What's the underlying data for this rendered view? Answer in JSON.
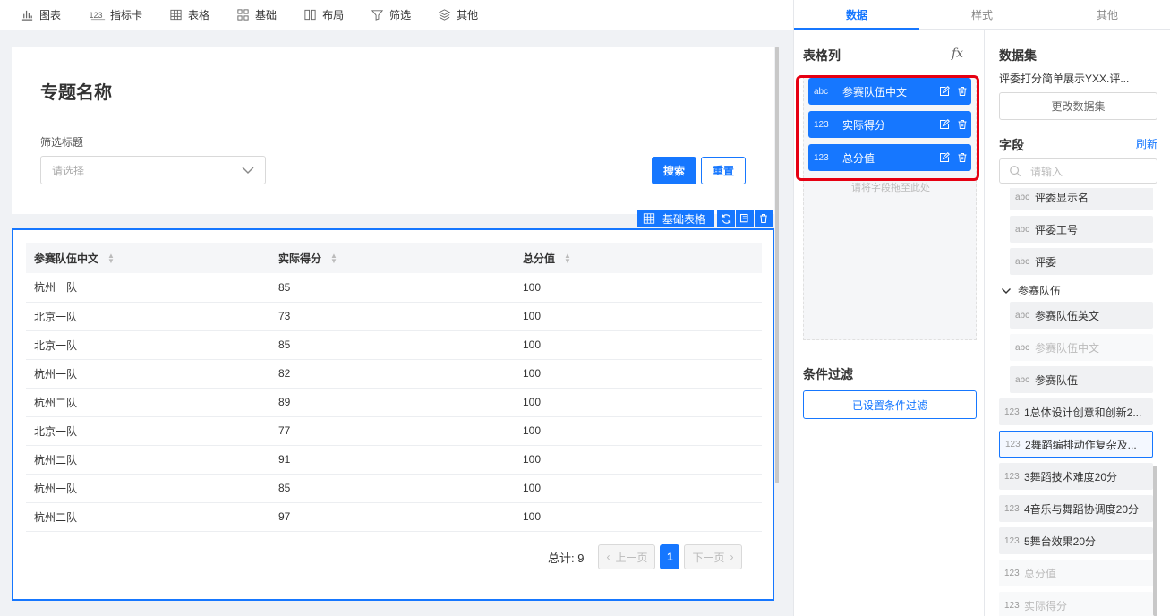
{
  "toolbar": {
    "items": [
      {
        "icon": "bar-chart-icon",
        "label": "图表"
      },
      {
        "icon": "number-icon",
        "label": "指标卡"
      },
      {
        "icon": "table-icon",
        "label": "表格"
      },
      {
        "icon": "grid-icon",
        "label": "基础"
      },
      {
        "icon": "layout-icon",
        "label": "布局"
      },
      {
        "icon": "filter-icon",
        "label": "筛选"
      },
      {
        "icon": "layers-icon",
        "label": "其他"
      }
    ]
  },
  "page": {
    "title": "专题名称",
    "filter_label": "筛选标题",
    "select_placeholder": "请选择",
    "search_button": "搜索",
    "reset_button": "重置"
  },
  "widget": {
    "name": "基础表格"
  },
  "table": {
    "headers": [
      "参赛队伍中文",
      "实际得分",
      "总分值"
    ],
    "rows": [
      [
        "杭州一队",
        "85",
        "100"
      ],
      [
        "北京一队",
        "73",
        "100"
      ],
      [
        "北京一队",
        "85",
        "100"
      ],
      [
        "杭州一队",
        "82",
        "100"
      ],
      [
        "杭州二队",
        "89",
        "100"
      ],
      [
        "北京一队",
        "77",
        "100"
      ],
      [
        "杭州二队",
        "91",
        "100"
      ],
      [
        "杭州一队",
        "85",
        "100"
      ],
      [
        "杭州二队",
        "97",
        "100"
      ]
    ],
    "pager": {
      "total": "总计: 9",
      "prev": "上一页",
      "page": "1",
      "next": "下一页"
    }
  },
  "panel": {
    "tabs": [
      "数据",
      "样式",
      "其他"
    ],
    "columns_title": "表格列",
    "columns": [
      {
        "type": "abc",
        "name": "参赛队伍中文"
      },
      {
        "type": "123",
        "name": "实际得分"
      },
      {
        "type": "123",
        "name": "总分值"
      }
    ],
    "drop_hint": "请将字段拖至此处",
    "condition_title": "条件过滤",
    "condition_button": "已设置条件过滤",
    "dataset_title": "数据集",
    "dataset_name": "评委打分简单展示YXX.评...",
    "change_dataset": "更改数据集",
    "fields_title": "字段",
    "refresh": "刷新",
    "search_placeholder": "请输入",
    "group_label": "参赛队伍",
    "fields": [
      {
        "type": "abc",
        "name": "评委显示名"
      },
      {
        "type": "abc",
        "name": "评委工号"
      },
      {
        "type": "abc",
        "name": "评委"
      },
      {
        "type": "abc",
        "name": "参赛队伍英文"
      },
      {
        "type": "abc",
        "name": "参赛队伍中文"
      },
      {
        "type": "abc",
        "name": "参赛队伍"
      },
      {
        "type": "123",
        "name": "1总体设计创意和创新2..."
      },
      {
        "type": "123",
        "name": "2舞蹈编排动作复杂及..."
      },
      {
        "type": "123",
        "name": "3舞蹈技术难度20分"
      },
      {
        "type": "123",
        "name": "4音乐与舞蹈协调度20分"
      },
      {
        "type": "123",
        "name": "5舞台效果20分"
      },
      {
        "type": "123",
        "name": "总分值"
      },
      {
        "type": "123",
        "name": "实际得分"
      }
    ]
  }
}
